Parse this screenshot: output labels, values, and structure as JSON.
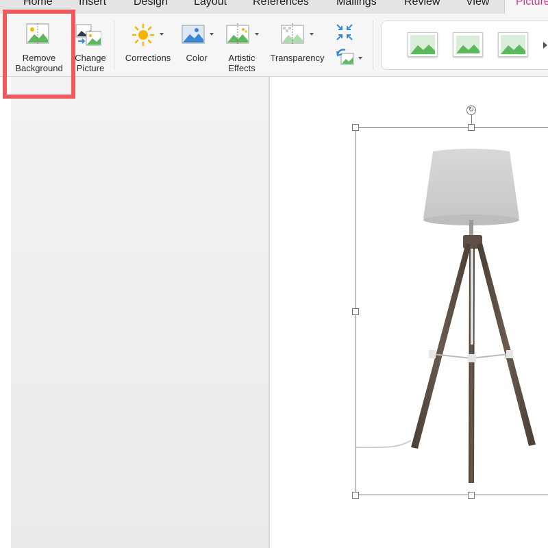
{
  "tabs": [
    "Home",
    "Insert",
    "Design",
    "Layout",
    "References",
    "Mailings",
    "Review",
    "View",
    "Picture"
  ],
  "active_tab": "Picture",
  "ribbon": {
    "remove_background": [
      "Remove",
      "Background"
    ],
    "change_picture": [
      "Change",
      "Picture"
    ],
    "corrections": "Corrections",
    "color": "Color",
    "artistic_effects": [
      "Artistic",
      "Effects"
    ],
    "transparency": "Transparency"
  },
  "colors": {
    "accent_tab": "#c73f8a",
    "highlight": "#f05a5f",
    "icon_green": "#5cb85c",
    "icon_blue": "#3a86d6",
    "sun": "#f5b400"
  },
  "icons": [
    "remove-background-icon",
    "change-picture-icon",
    "corrections-icon",
    "color-icon",
    "artistic-effects-icon",
    "transparency-icon",
    "compress-icon",
    "reset-picture-icon"
  ]
}
